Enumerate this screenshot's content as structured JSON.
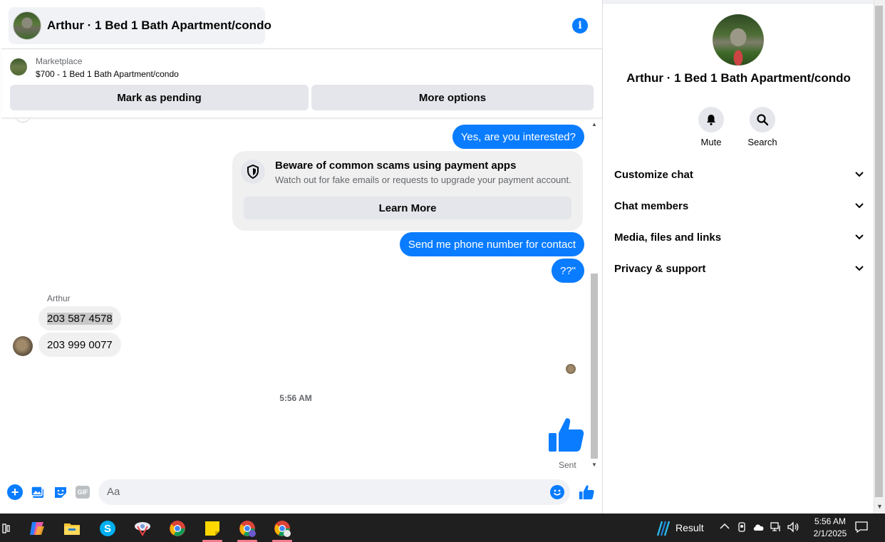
{
  "header": {
    "title": "Arthur · 1 Bed 1 Bath Apartment/condo"
  },
  "marketplace": {
    "label": "Marketplace",
    "listing": "$700 - 1 Bed 1 Bath Apartment/condo",
    "mark_pending": "Mark as pending",
    "more_options": "More options"
  },
  "messages": {
    "out_1": "Yes, are you interested?",
    "scam_title": "Beware of common scams using payment apps",
    "scam_desc": "Watch out for fake emails or requests to upgrade your payment account.",
    "learn_more": "Learn More",
    "out_2": "Send me phone number for contact",
    "out_3": "??\"",
    "sender": "Arthur",
    "in_1": "203 587 4578",
    "in_2": "203 999 0077",
    "timestamp": "5:56 AM",
    "sent_status": "Sent"
  },
  "composer": {
    "placeholder": "Aa",
    "gif": "GIF"
  },
  "details": {
    "name": "Arthur · 1 Bed 1 Bath Apartment/condo",
    "actions": [
      {
        "label": "Mute",
        "icon": "bell-icon"
      },
      {
        "label": "Search",
        "icon": "search-icon"
      }
    ],
    "sections": [
      {
        "label": "Customize chat"
      },
      {
        "label": "Chat members"
      },
      {
        "label": "Media, files and links"
      },
      {
        "label": "Privacy & support"
      }
    ]
  },
  "taskbar": {
    "weather_text": "Result",
    "time": "5:56 AM",
    "date": "2/1/2025"
  },
  "colors": {
    "accent": "#0a7cff",
    "bubble_in": "#f0f0f0",
    "button_gray": "#e4e6eb",
    "taskbar": "#1f1f1f"
  }
}
